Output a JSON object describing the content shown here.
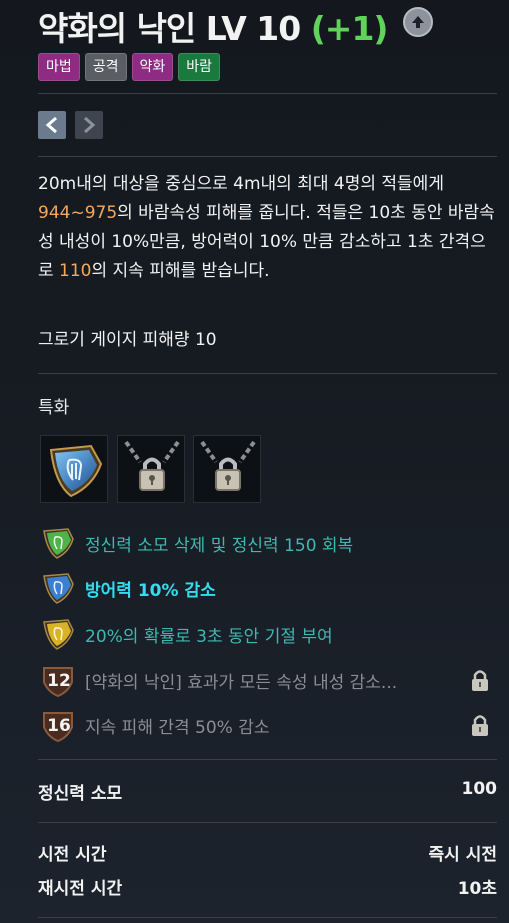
{
  "skill": {
    "name": "약화의 낙인 LV 10",
    "bonus": "(+1)"
  },
  "tags": [
    {
      "label": "마법",
      "color": "#8e2c84"
    },
    {
      "label": "공격",
      "color": "#5a5d62"
    },
    {
      "label": "약화",
      "color": "#8e2c84"
    },
    {
      "label": "바람",
      "color": "#1a7a3e"
    }
  ],
  "description": {
    "part1": "20m내의 대상을 중심으로 4m내의 최대 4명의 적들에게 ",
    "damage": "944~975",
    "part2": "의 바람속성 피해를 줍니다. 적들은 10초 동안 바람속성 내성이 10%만큼, 방어력이 10% 만큼 감소하고 1초 간격으로 ",
    "dot": "110",
    "part3": "의 지속 피해를 받습니다."
  },
  "gauge_text": "그로기 게이지 피해량 10",
  "specialization": {
    "label": "특화",
    "slots": [
      "harp-shield-icon",
      "chain-lock-icon",
      "chain-lock-icon"
    ]
  },
  "tripods": [
    {
      "text": "정신력 소모 삭제 및 정신력 150 회복",
      "color": "#3fb9b0",
      "icon": "green-shield-icon"
    },
    {
      "text": "방어력 10% 감소",
      "color": "#35dcee",
      "icon": "blue-shield-icon"
    },
    {
      "text": "20%의 확률로 3초 동안 기절 부여",
      "color": "#3fb9b0",
      "icon": "gold-shield-icon"
    },
    {
      "text": "[약화의 낙인] 효과가 모든 속성 내성 감소...",
      "color": "#8a8e94",
      "level": "12"
    },
    {
      "text": "지속 피해 간격 50% 감소",
      "color": "#8a8e94",
      "level": "16"
    }
  ],
  "stats": {
    "mp_label": "정신력 소모",
    "mp_value": "100",
    "cast_label": "시전 시간",
    "cast_value": "즉시 시전",
    "cooldown_label": "재시전 시간",
    "cooldown_value": "10초"
  }
}
